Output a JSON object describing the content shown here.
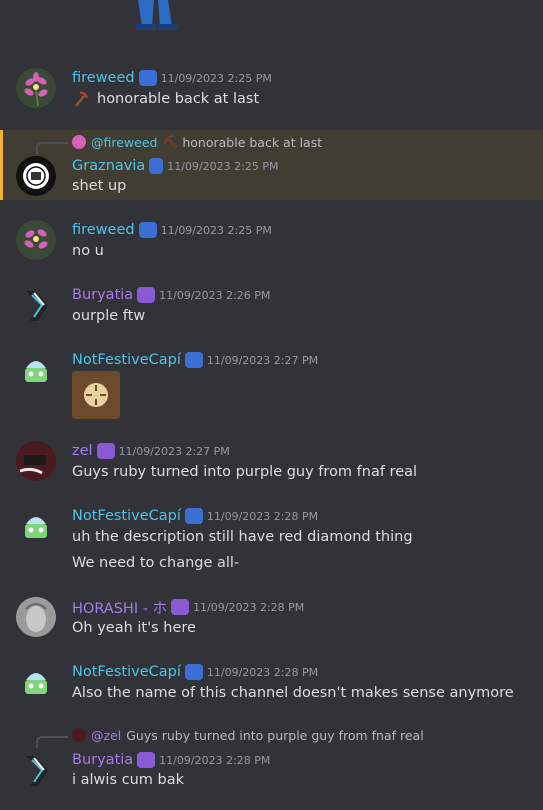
{
  "colors": {
    "background": "#313338",
    "highlight_bg": "#403d33",
    "highlight_border": "#f0b232",
    "timestamp": "#949ba4",
    "text": "#dbdee1",
    "name_blue": "#4fc3e8",
    "name_purple": "#a57ce8"
  },
  "messages": [
    {
      "author": "fireweed",
      "name_color": "blue",
      "timestamp": "11/09/2023 2:25 PM",
      "lines": [
        "honorable back at last"
      ],
      "emoji_prefix": "pickaxe-emoji"
    },
    {
      "author": "Graznavia",
      "name_color": "blue",
      "timestamp": "11/09/2023 2:25 PM",
      "lines": [
        "shet up"
      ],
      "reply_to": {
        "mention": "@fireweed",
        "text": "honorable back at last"
      }
    },
    {
      "author": "fireweed",
      "name_color": "blue",
      "timestamp": "11/09/2023 2:25 PM",
      "lines": [
        "no u"
      ]
    },
    {
      "author": "Buryatia",
      "name_color": "purple",
      "timestamp": "11/09/2023 2:26 PM",
      "lines": [
        "ourple ftw"
      ]
    },
    {
      "author": "NotFestiveCapí",
      "name_color": "blue",
      "timestamp": "11/09/2023 2:27 PM",
      "lines": []
    },
    {
      "author": "zel",
      "name_color": "purple",
      "timestamp": "11/09/2023 2:27 PM",
      "lines": [
        "Guys ruby turned into purple guy from fnaf real"
      ]
    },
    {
      "author": "NotFestiveCapí",
      "name_color": "blue",
      "timestamp": "11/09/2023 2:28 PM",
      "lines": [
        "uh the description still have red diamond thing",
        "We need to change all-"
      ]
    },
    {
      "author": "HORASHI - ホ",
      "name_color": "purple",
      "timestamp": "11/09/2023 2:28 PM",
      "lines": [
        "Oh yeah it's here"
      ]
    },
    {
      "author": "NotFestiveCapí",
      "name_color": "blue",
      "timestamp": "11/09/2023 2:28 PM",
      "lines": [
        "Also the name of this channel doesn't makes sense anymore"
      ]
    },
    {
      "author": "Buryatia",
      "name_color": "purple",
      "timestamp": "11/09/2023 2:28 PM",
      "lines": [
        "i alwis cum bak"
      ],
      "reply_to": {
        "mention": "@zel",
        "text": "Guys ruby turned into purple guy from fnaf real"
      }
    }
  ]
}
